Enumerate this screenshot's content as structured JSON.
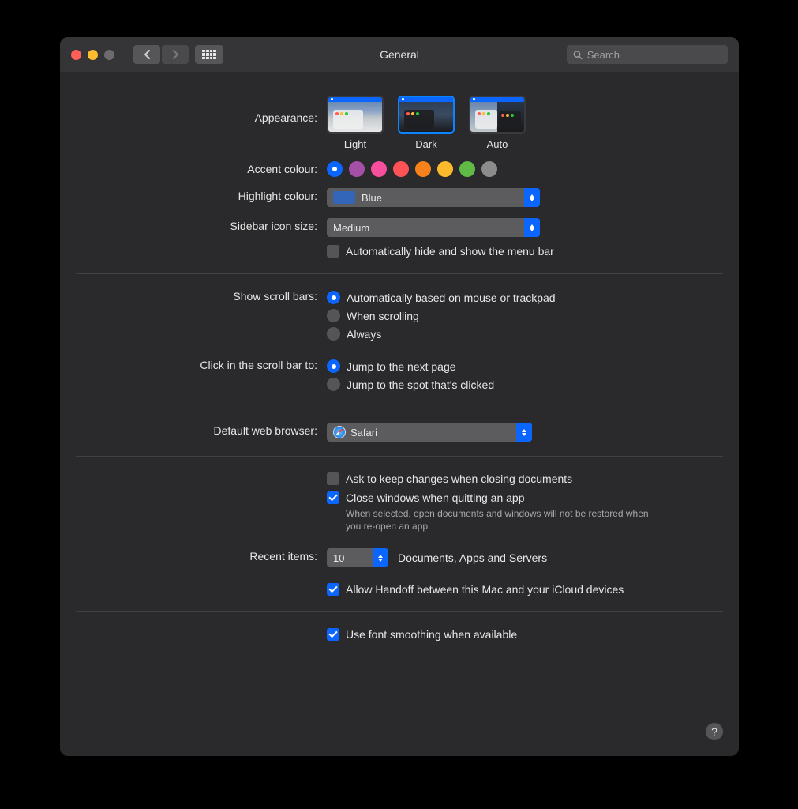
{
  "window": {
    "title": "General"
  },
  "search": {
    "placeholder": "Search"
  },
  "labels": {
    "appearance": "Appearance:",
    "accent": "Accent colour:",
    "highlight": "Highlight colour:",
    "sidebar": "Sidebar icon size:",
    "autohide_menubar": "Automatically hide and show the menu bar",
    "scrollbars": "Show scroll bars:",
    "click_scrollbar": "Click in the scroll bar to:",
    "default_browser": "Default web browser:",
    "ask_keep_changes": "Ask to keep changes when closing documents",
    "close_windows": "Close windows when quitting an app",
    "close_windows_note": "When selected, open documents and windows will not be restored when you re-open an app.",
    "recent_items": "Recent items:",
    "recent_items_suffix": "Documents, Apps and Servers",
    "handoff": "Allow Handoff between this Mac and your iCloud devices",
    "font_smoothing": "Use font smoothing when available"
  },
  "appearance_options": {
    "light": "Light",
    "dark": "Dark",
    "auto": "Auto",
    "selected": "dark"
  },
  "accent_colours": [
    {
      "name": "blue",
      "hex": "#0a66ff",
      "selected": true
    },
    {
      "name": "purple",
      "hex": "#a550a7",
      "selected": false
    },
    {
      "name": "pink",
      "hex": "#f74f9e",
      "selected": false
    },
    {
      "name": "red",
      "hex": "#ff5257",
      "selected": false
    },
    {
      "name": "orange",
      "hex": "#f7821b",
      "selected": false
    },
    {
      "name": "yellow",
      "hex": "#fdbb2c",
      "selected": false
    },
    {
      "name": "green",
      "hex": "#62ba46",
      "selected": false
    },
    {
      "name": "graphite",
      "hex": "#8c8c8c",
      "selected": false
    }
  ],
  "highlight_value": "Blue",
  "sidebar_value": "Medium",
  "scrollbars_options": {
    "auto": "Automatically based on mouse or trackpad",
    "scrolling": "When scrolling",
    "always": "Always",
    "selected": "auto"
  },
  "click_scrollbar_options": {
    "next_page": "Jump to the next page",
    "spot": "Jump to the spot that's clicked",
    "selected": "next_page"
  },
  "default_browser_value": "Safari",
  "recent_items_value": "10",
  "checkboxes": {
    "autohide_menubar": false,
    "ask_keep_changes": false,
    "close_windows": true,
    "handoff": true,
    "font_smoothing": true
  },
  "help_glyph": "?"
}
